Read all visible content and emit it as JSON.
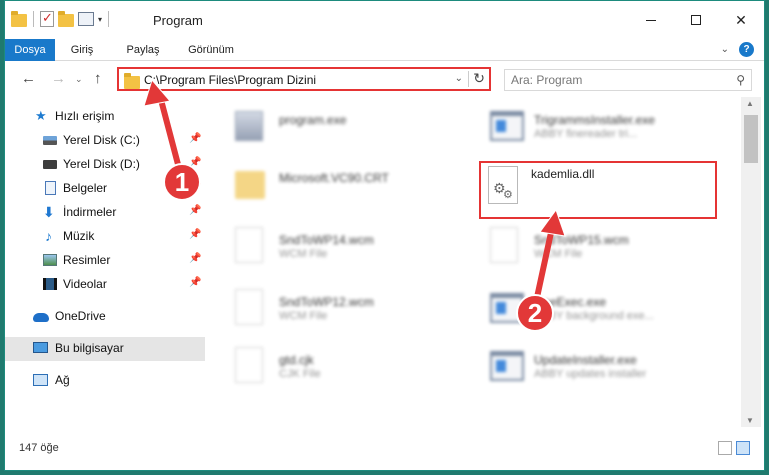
{
  "window": {
    "title": "Program",
    "min_icon": "minimize-icon",
    "max_icon": "maximize-icon",
    "close_glyph": "✕"
  },
  "ribbon": {
    "tabs": [
      "Dosya",
      "Giriş",
      "Paylaş",
      "Görünüm"
    ],
    "active_tab": "Dosya",
    "help_glyph": "?"
  },
  "nav": {
    "back": "←",
    "forward": "→",
    "history": "⌄",
    "up": "↑",
    "address": "C:\\Program Files\\Program Dizini",
    "search_placeholder": "Ara: Program"
  },
  "sidebar": {
    "items": [
      {
        "label": "Hızlı erişim",
        "icon": "star-icon"
      },
      {
        "label": "Yerel Disk (C:)",
        "icon": "disk-icon",
        "pinned": true
      },
      {
        "label": "Yerel Disk (D:)",
        "icon": "disk-icon",
        "pinned": true
      },
      {
        "label": "Belgeler",
        "icon": "document-icon",
        "pinned": true
      },
      {
        "label": "İndirmeler",
        "icon": "download-icon",
        "pinned": true
      },
      {
        "label": "Müzik",
        "icon": "music-icon",
        "pinned": true
      },
      {
        "label": "Resimler",
        "icon": "pictures-icon",
        "pinned": true
      },
      {
        "label": "Videolar",
        "icon": "videos-icon",
        "pinned": true
      },
      {
        "label": "OneDrive",
        "icon": "cloud-icon"
      },
      {
        "label": "Bu bilgisayar",
        "icon": "computer-icon",
        "selected": true
      },
      {
        "label": "Ağ",
        "icon": "network-icon"
      }
    ]
  },
  "files": [
    {
      "name": "program.exe",
      "type": "",
      "icon": "exe-icon"
    },
    {
      "name": "TrigrammsInstaller.exe",
      "type": "ABBY finereader tri...",
      "icon": "app-icon"
    },
    {
      "name": "Microsoft.VC90.CRT",
      "type": "",
      "icon": "folder-icon"
    },
    {
      "name": "kademlia.dll",
      "type": "",
      "icon": "dll-icon",
      "highlighted": true
    },
    {
      "name": "SndToWP14.wcm",
      "type": "WCM File",
      "icon": "file-icon"
    },
    {
      "name": "SndToWP15.wcm",
      "type": "WCM File",
      "icon": "file-icon"
    },
    {
      "name": "SndToWP12.wcm",
      "type": "WCM File",
      "icon": "file-icon"
    },
    {
      "name": "OneExec.exe",
      "type": "ABBY background exe...",
      "icon": "app-icon"
    },
    {
      "name": "gtd.cjk",
      "type": "CJK File",
      "icon": "file-icon"
    },
    {
      "name": "UpdateInstaller.exe",
      "type": "ABBY updates installer",
      "icon": "app-icon"
    }
  ],
  "status": {
    "count": "147 öğe"
  },
  "annotations": {
    "step1": "1",
    "step2": "2",
    "color": "#e23838"
  }
}
